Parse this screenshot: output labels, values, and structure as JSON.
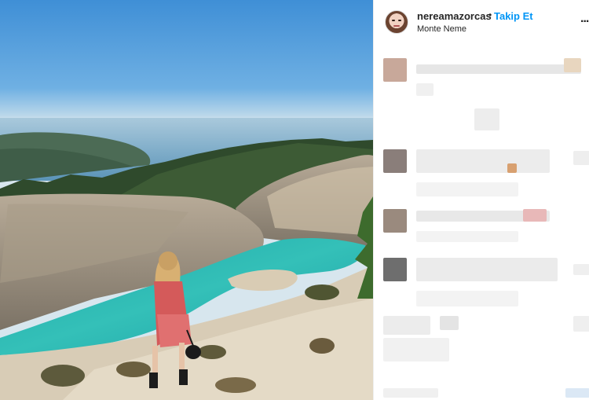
{
  "post": {
    "username": "nereamazorcas",
    "separator": "•",
    "follow_label": "Takip Et",
    "location": "Monte Neme",
    "more_icon": "more-horizontal-icon",
    "more_glyph": "..."
  },
  "colors": {
    "follow": "#0095f6",
    "text": "#262626",
    "lake": "#2fb9b3"
  }
}
